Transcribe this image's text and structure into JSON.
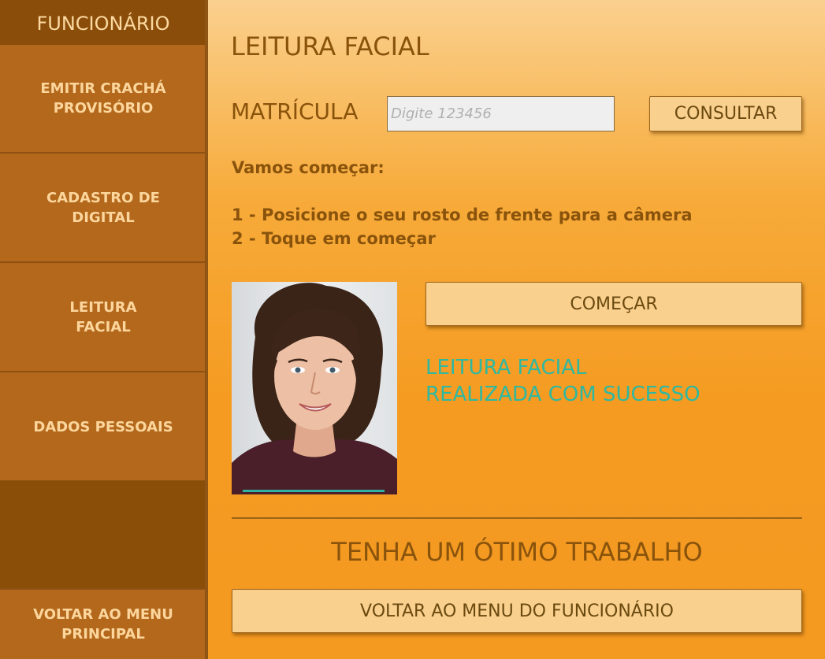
{
  "sidebar": {
    "title": "FUNCIONÁRIO",
    "items": [
      {
        "label": "EMITIR CRACHÁ\nPROVISÓRIO"
      },
      {
        "label": "CADASTRO DE\nDIGITAL"
      },
      {
        "label": "LEITURA\nFACIAL"
      },
      {
        "label": "DADOS PESSOAIS"
      }
    ],
    "back_label": "VOLTAR AO MENU\nPRINCIPAL"
  },
  "main": {
    "title": "LEITURA FACIAL",
    "matricula_label": "MATRÍCULA",
    "matricula_placeholder": "Digite 123456",
    "matricula_value": "",
    "consultar_label": "CONSULTAR",
    "instructions": {
      "intro": "Vamos começar:",
      "step1": "1 - Posicione o seu rosto de frente para a câmera",
      "step2": "2 - Toque em começar"
    },
    "comecar_label": "COMEÇAR",
    "success_line1": "LEITURA FACIAL",
    "success_line2": "REALIZADA COM SUCESSO",
    "footer_message": "TENHA UM ÓTIMO TRABALHO",
    "voltar_label": "VOLTAR AO MENU DO FUNCIONÁRIO"
  },
  "colors": {
    "sidebar_bg": "#b3681c",
    "sidebar_dark": "#8a4e08",
    "accent_text": "#8a530c",
    "button_bg": "#fad08e",
    "success": "#2fb8a0"
  }
}
